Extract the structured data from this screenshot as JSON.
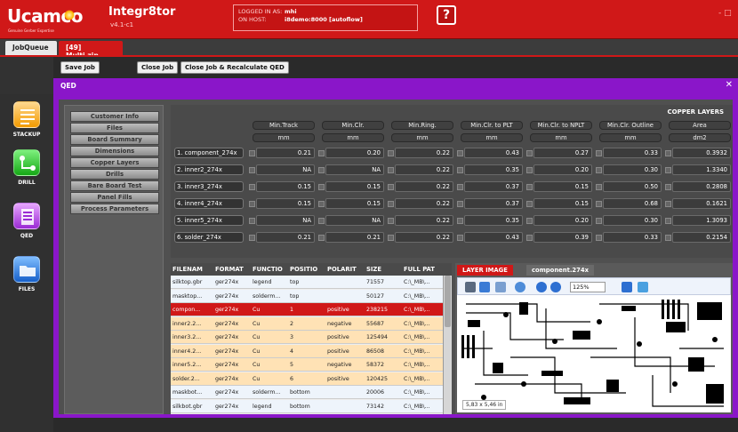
{
  "header": {
    "logo": "Ucamco",
    "logo_tagline": "Genuine Gerber Expertise",
    "app_name": "Integr8tor",
    "app_version": "v4.1-c1",
    "logged_in_label": "LOGGED IN AS:",
    "logged_in_value": "mhi",
    "host_label": "ON HOST:",
    "host_value": "i8demo:8000 [autoflow]",
    "help_label": "?",
    "window_controls": "- □"
  },
  "tabs": [
    {
      "label": "JobQueue"
    },
    {
      "label": "[49] Multi.zip"
    }
  ],
  "toolbar": {
    "save_job": "Save Job",
    "close_job": "Close Job",
    "close_recalc": "Close Job & Recalculate QED"
  },
  "panel": {
    "title": "QED",
    "close": "✕"
  },
  "leftnav": [
    {
      "label": "STACKUP",
      "icon": "stackup-icon"
    },
    {
      "label": "DRILL",
      "icon": "drill-icon"
    },
    {
      "label": "QED",
      "icon": "qed-icon"
    },
    {
      "label": "FILES",
      "icon": "files-icon"
    }
  ],
  "sidenav": [
    "Customer Info",
    "Files",
    "Board Summary",
    "Dimensions",
    "Copper Layers",
    "Drills",
    "Bare Board Test",
    "Panel Fills",
    "Process Parameters"
  ],
  "copper": {
    "title": "COPPER LAYERS",
    "columns": [
      "Min.Track",
      "Min.Clr.",
      "Min.Ring.",
      "Min.Clr. to PLT",
      "Min.Clr. to NPLT",
      "Min.Clr. Outline",
      "Area"
    ],
    "units": [
      "mm",
      "mm",
      "mm",
      "mm",
      "mm",
      "mm",
      "dm2"
    ],
    "rows": [
      {
        "label": "1. component_274x",
        "values": [
          "0.21",
          "0.20",
          "0.22",
          "0.43",
          "0.27",
          "0.33",
          "0.3932"
        ]
      },
      {
        "label": "2. inner2_274x",
        "values": [
          "NA",
          "NA",
          "0.22",
          "0.35",
          "0.20",
          "0.30",
          "1.3340"
        ]
      },
      {
        "label": "3. inner3_274x",
        "values": [
          "0.15",
          "0.15",
          "0.22",
          "0.37",
          "0.15",
          "0.50",
          "0.2808"
        ]
      },
      {
        "label": "4. inner4_274x",
        "values": [
          "0.15",
          "0.15",
          "0.22",
          "0.37",
          "0.15",
          "0.68",
          "0.1621"
        ]
      },
      {
        "label": "5. inner5_274x",
        "values": [
          "NA",
          "NA",
          "0.22",
          "0.35",
          "0.20",
          "0.30",
          "1.3093"
        ]
      },
      {
        "label": "6. solder_274x",
        "values": [
          "0.21",
          "0.21",
          "0.22",
          "0.43",
          "0.39",
          "0.33",
          "0.2154"
        ]
      }
    ]
  },
  "files": {
    "columns": [
      "FILENAM",
      "FORMAT",
      "FUNCTIO",
      "POSITIO",
      "POLARIT",
      "SIZE",
      "FULL PAT"
    ],
    "rows": [
      {
        "name": "silktop.gbr",
        "format": "ger274x",
        "func": "legend",
        "pos": "top",
        "pol": "",
        "size": "71557",
        "path": "C:\\_MB\\..."
      },
      {
        "name": "masktop...",
        "format": "ger274x",
        "func": "solderm...",
        "pos": "top",
        "pol": "",
        "size": "50127",
        "path": "C:\\_MB\\..."
      },
      {
        "name": "compon...",
        "format": "ger274x",
        "func": "Cu",
        "pos": "1",
        "pol": "positive",
        "size": "238215",
        "path": "C:\\_MB\\..."
      },
      {
        "name": "inner2.2...",
        "format": "ger274x",
        "func": "Cu",
        "pos": "2",
        "pol": "negative",
        "size": "55687",
        "path": "C:\\_MB\\..."
      },
      {
        "name": "inner3.2...",
        "format": "ger274x",
        "func": "Cu",
        "pos": "3",
        "pol": "positive",
        "size": "125494",
        "path": "C:\\_MB\\..."
      },
      {
        "name": "inner4.2...",
        "format": "ger274x",
        "func": "Cu",
        "pos": "4",
        "pol": "positive",
        "size": "86508",
        "path": "C:\\_MB\\..."
      },
      {
        "name": "inner5.2...",
        "format": "ger274x",
        "func": "Cu",
        "pos": "5",
        "pol": "negative",
        "size": "58372",
        "path": "C:\\_MB\\..."
      },
      {
        "name": "solder.2...",
        "format": "ger274x",
        "func": "Cu",
        "pos": "6",
        "pol": "positive",
        "size": "120425",
        "path": "C:\\_MB\\..."
      },
      {
        "name": "maskbot...",
        "format": "ger274x",
        "func": "solderm...",
        "pos": "bottom",
        "pol": "",
        "size": "20006",
        "path": "C:\\_MB\\..."
      },
      {
        "name": "silkbot.gbr",
        "format": "ger274x",
        "func": "legend",
        "pos": "bottom",
        "pol": "",
        "size": "73142",
        "path": "C:\\_MB\\..."
      }
    ],
    "selected_index": 2
  },
  "layer": {
    "tab_active": "LAYER IMAGE",
    "tab_file": "component.274x",
    "zoom": "125%",
    "dimensions": "5,83 x 5,46 in"
  },
  "colors": {
    "header_red": "#d01818",
    "panel_purple": "#8a16c9",
    "row_selected": "#d01818",
    "row_cu": "#ffe2b5",
    "row_other": "#eef4fb"
  }
}
